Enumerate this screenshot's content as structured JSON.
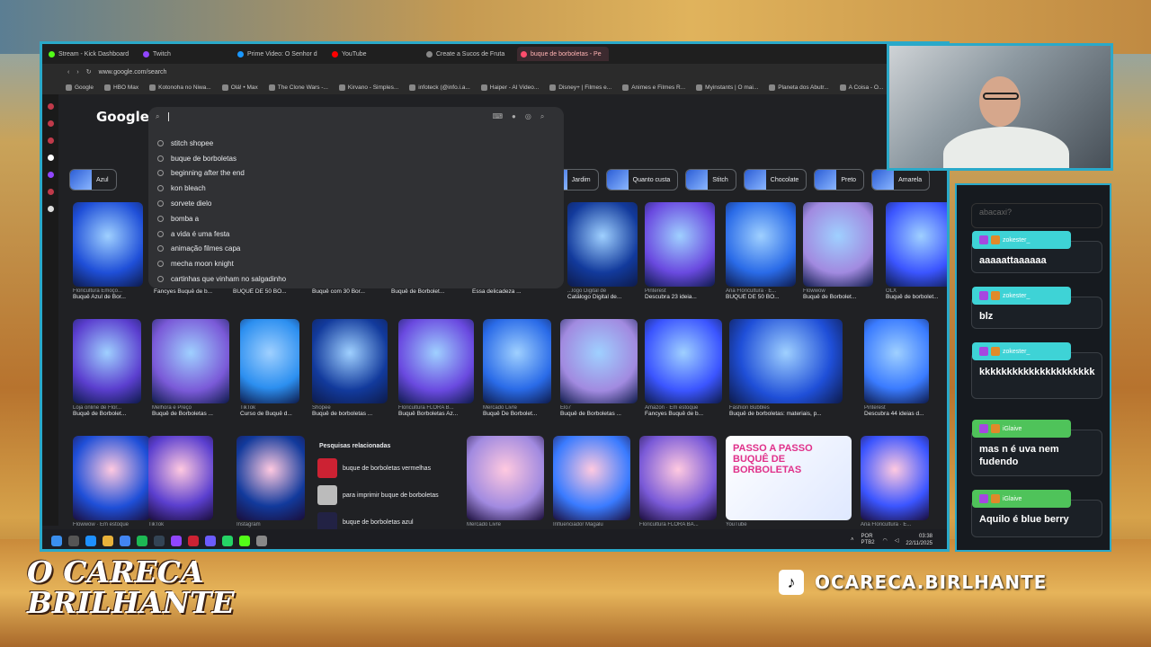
{
  "browser": {
    "tabs": [
      {
        "label": "Stream - Kick Dashboard",
        "color": "#53fc18",
        "active": false
      },
      {
        "label": "Twitch",
        "color": "#9146ff",
        "active": false
      },
      {
        "label": "Prime Video: O Senhor d",
        "color": "#1a98ff",
        "active": false
      },
      {
        "label": "YouTube",
        "color": "#ff0000",
        "active": false
      },
      {
        "label": "Create a Sucos de Fruta",
        "color": "#888888",
        "active": false
      },
      {
        "label": "buque de borboletas - Pe",
        "color": "#ff4d6d",
        "active": true
      }
    ],
    "url": "www.google.com/search",
    "bookmarks": [
      "Google",
      "HBO Max",
      "Kotonoha no Niwa...",
      "Olá! • Max",
      "The Clone Wars -...",
      "Kirvano - Simples...",
      "infoteck (@info.i.a...",
      "Haiper - AI Video...",
      "Disney+ | Filmes e...",
      "Animes e Filmes R...",
      "Myinstants | O mai...",
      "Planeta dos Abutr...",
      "A Coisa - O..."
    ]
  },
  "google": {
    "logo": "Google",
    "search_value": "",
    "suggestions": [
      "stitch shopee",
      "buque de borboletas",
      "beginning after the end",
      "kon bleach",
      "sorvete dielo",
      "bomba a",
      "a vida é uma festa",
      "animação filmes capa",
      "mecha moon knight",
      "cartinhas que vinham no salgadinho"
    ],
    "chips": [
      "Azul",
      "Jardim",
      "Quanto custa",
      "Stitch",
      "Chocolate",
      "Preto",
      "Amarela"
    ],
    "row1": [
      {
        "source": "Floricultura Emoçõ...",
        "caption": "Buquê Azul de Bor..."
      },
      {
        "source": "",
        "caption": "Fancyes Buquê de b..."
      },
      {
        "source": "",
        "caption": "BUQUÊ DE 50 BO..."
      },
      {
        "source": "",
        "caption": "Buquê com 30 Bor..."
      },
      {
        "source": "",
        "caption": "Buquê de Borbolet..."
      },
      {
        "source": "",
        "caption": "Essa delicadeza ..."
      },
      {
        "source": "...logo Digital de",
        "caption": "Catálogo Digital de..."
      },
      {
        "source": "Pinterest",
        "caption": "Descubra 23 ideia..."
      },
      {
        "source": "Ana Floricultura · E...",
        "caption": "BUQUÊ DE 50 BO..."
      },
      {
        "source": "Flowwow",
        "caption": "Buquê de Borbolet..."
      },
      {
        "source": "OLX",
        "caption": "Buquê de borbolet..."
      }
    ],
    "row2": [
      {
        "source": "Loja online de Flor...",
        "caption": "Buquê de Borbolet..."
      },
      {
        "source": "Melhora e Preço",
        "caption": "Buquê de Borboletas ..."
      },
      {
        "source": "TikTok",
        "caption": "Curso de Buquê d..."
      },
      {
        "source": "Shopee",
        "caption": "Buquê de borboletas ..."
      },
      {
        "source": "Floricultura FLORA B...",
        "caption": "Buquê Borboletas Az..."
      },
      {
        "source": "Mercado Livre",
        "caption": "Buquê De Borbolet..."
      },
      {
        "source": "Elo7",
        "caption": "Buquê de Borboletas ..."
      },
      {
        "source": "Amazon · Em estoque",
        "caption": "Fancyes Buquê de b..."
      },
      {
        "source": "Fashion Bubbles",
        "caption": "Buquê de borboletas: materiais, p..."
      },
      {
        "source": "Pinterest",
        "caption": "Descubra 44 ideias d..."
      }
    ],
    "row3_sources": [
      "Flowwow · Em estoque",
      "TikTok",
      "Instagram",
      "Mercado Livre",
      "Influenciador Magalu",
      "Floricultura FLORA BA...",
      "YouTube",
      "Ana Floricultura · E..."
    ],
    "related": {
      "title": "Pesquisas relacionadas",
      "items": [
        "buque de borboletas vermelhas",
        "para imprimir buque de borboletas",
        "buque de borboletas azul"
      ]
    },
    "promo_text": "PASSO A PASSO BUQUÊ DE BORBOLETAS"
  },
  "taskbar": {
    "lang": "POR PTB2",
    "time": "03:38",
    "date": "22/11/2025"
  },
  "chat": {
    "faded": "abacaxi?",
    "messages": [
      {
        "user": "zokester_",
        "text": "aaaaattaaaaaa",
        "color": "#3ed3d6"
      },
      {
        "user": "zokester_",
        "text": "blz",
        "color": "#3ed3d6"
      },
      {
        "user": "zokester_",
        "text": "kkkkkkkkkkkkkkkkkkkkk",
        "color": "#3ed3d6"
      },
      {
        "user": "iGlaive",
        "text": "mas n é uva nem fudendo",
        "color": "#4fc35a"
      },
      {
        "user": "iGlaive",
        "text": "Aquilo é blue berry",
        "color": "#4fc35a"
      }
    ]
  },
  "overlay": {
    "logo_line1": "O CARECA",
    "logo_line2": "BRILHANTE",
    "tiktok_handle": "OCARECA.BIRLHANTE"
  }
}
